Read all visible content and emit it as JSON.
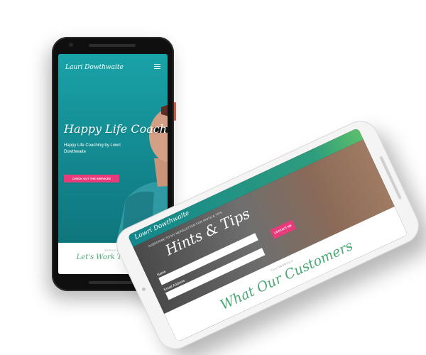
{
  "phone_home": {
    "logo": "Lauri Dowthwaite",
    "hero_title": "Happy Life Coaching",
    "hero_subtitle": "Happy Life Coaching by Lowri Dowthwaite",
    "cta_label": "CHECK OUT THE SERVICES",
    "services_label": "SERVICES",
    "services_heading": "Let's Work Together"
  },
  "phone_tips": {
    "logo": "Lowri Dowthwaite",
    "subtitle": "SUBSCRIBE TO MY NEWSLETTER FOR HINTS & TIPS",
    "title": "Hints & Tips",
    "name_label": "Name",
    "email_label": "Email Address",
    "button_label": "CONTACT ME",
    "testimonials_label": "TESTIMONIALS",
    "testimonials_heading": "What Our Customers"
  },
  "colors": {
    "teal": "#12848b",
    "pink": "#e93a7b",
    "green_heading": "#4aa874"
  }
}
